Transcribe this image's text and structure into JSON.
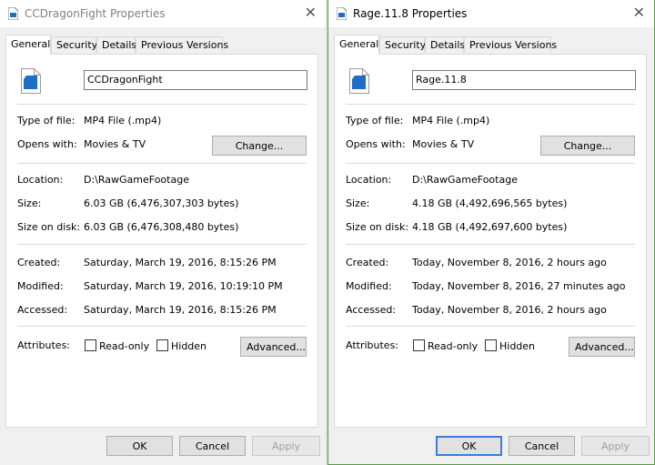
{
  "left": {
    "title": "CCDragonFight Properties",
    "tabs": [
      "General",
      "Security",
      "Details",
      "Previous Versions"
    ],
    "name": "CCDragonFight",
    "type_label": "Type of file:",
    "type_value": "MP4 File (.mp4)",
    "opens_label": "Opens with:",
    "opens_value": "Movies & TV",
    "change_label": "Change...",
    "location_label": "Location:",
    "location_value": "D:\\RawGameFootage",
    "size_label": "Size:",
    "size_value": "6.03 GB (6,476,307,303 bytes)",
    "disk_label": "Size on disk:",
    "disk_value": "6.03 GB (6,476,308,480 bytes)",
    "created_label": "Created:",
    "created_value": "Saturday, March 19, 2016, 8:15:26 PM",
    "modified_label": "Modified:",
    "modified_value": "Saturday, March 19, 2016, 10:19:10 PM",
    "accessed_label": "Accessed:",
    "accessed_value": "Saturday, March 19, 2016, 8:15:26 PM",
    "attributes_label": "Attributes:",
    "readonly_label": "Read-only",
    "hidden_label": "Hidden",
    "advanced_label": "Advanced...",
    "ok_label": "OK",
    "cancel_label": "Cancel",
    "apply_label": "Apply"
  },
  "right": {
    "title": "Rage.11.8 Properties",
    "tabs": [
      "General",
      "Security",
      "Details",
      "Previous Versions"
    ],
    "name": "Rage.11.8",
    "type_label": "Type of file:",
    "type_value": "MP4 File (.mp4)",
    "opens_label": "Opens with:",
    "opens_value": "Movies & TV",
    "change_label": "Change...",
    "location_label": "Location:",
    "location_value": "D:\\RawGameFootage",
    "size_label": "Size:",
    "size_value": "4.18 GB (4,492,696,565 bytes)",
    "disk_label": "Size on disk:",
    "disk_value": "4.18 GB (4,492,697,600 bytes)",
    "created_label": "Created:",
    "created_value": "Today, November 8, 2016, 2 hours ago",
    "modified_label": "Modified:",
    "modified_value": "Today, November 8, 2016, 27 minutes ago",
    "accessed_label": "Accessed:",
    "accessed_value": "Today, November 8, 2016, 2 hours ago",
    "attributes_label": "Attributes:",
    "readonly_label": "Read-only",
    "hidden_label": "Hidden",
    "advanced_label": "Advanced...",
    "ok_label": "OK",
    "cancel_label": "Cancel",
    "apply_label": "Apply"
  },
  "icons": {
    "title": "video-file-icon",
    "file": "video-file-icon",
    "close": "close-icon"
  },
  "colors": {
    "accent": "#3a7fd5",
    "file_icon": "#1e6fc4",
    "active_border": "#5a9a4a"
  }
}
